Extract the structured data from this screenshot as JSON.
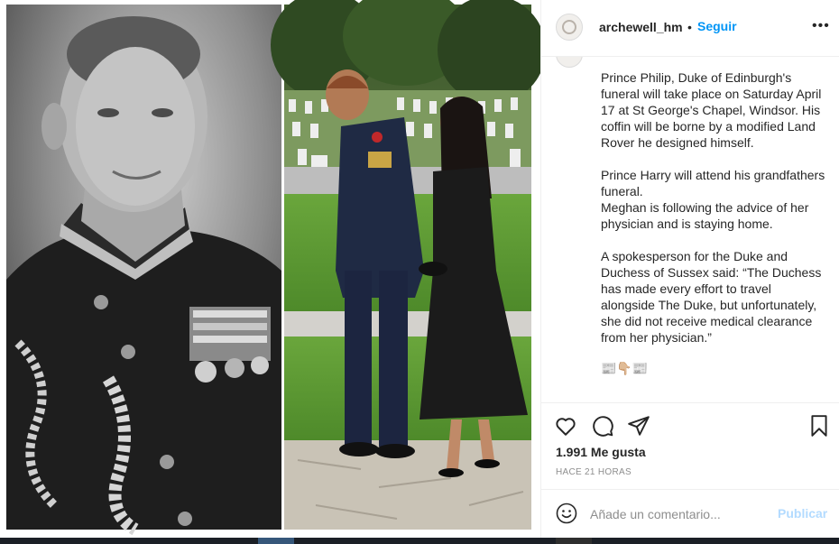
{
  "post": {
    "username": "archewell_hm",
    "separator": "•",
    "follow_label": "Seguir",
    "more_label": "•••",
    "images": [
      {
        "description_icon": "portrait-photo-icon"
      },
      {
        "description_icon": "couple-photo-icon"
      }
    ]
  },
  "caption": {
    "text": "Prince Philip, Duke of Edinburgh's funeral will take place on Saturday April 17 at St George's Chapel, Windsor. His coffin will be borne by a modified Land Rover he designed himself.\n\nPrince Harry will attend his grandfathers funeral.\nMeghan is following the advice of her physician and is staying home.\n\nA spokesperson for the Duke and Duchess of Sussex said: “The Duchess has made every effort to travel alongside The Duke, but unfortunately, she did not receive medical clearance from her physician.”",
    "emoji": "📰👇🏼📰"
  },
  "actions": {
    "likes": "1.991 Me gusta",
    "time": "HACE 21 HORAS"
  },
  "comment": {
    "placeholder": "Añade un comentario...",
    "publish_label": "Publicar"
  },
  "colors": {
    "accent": "#0095f6",
    "publish_disabled": "#b3dbff",
    "text": "#262626",
    "muted": "#8e8e8e"
  }
}
